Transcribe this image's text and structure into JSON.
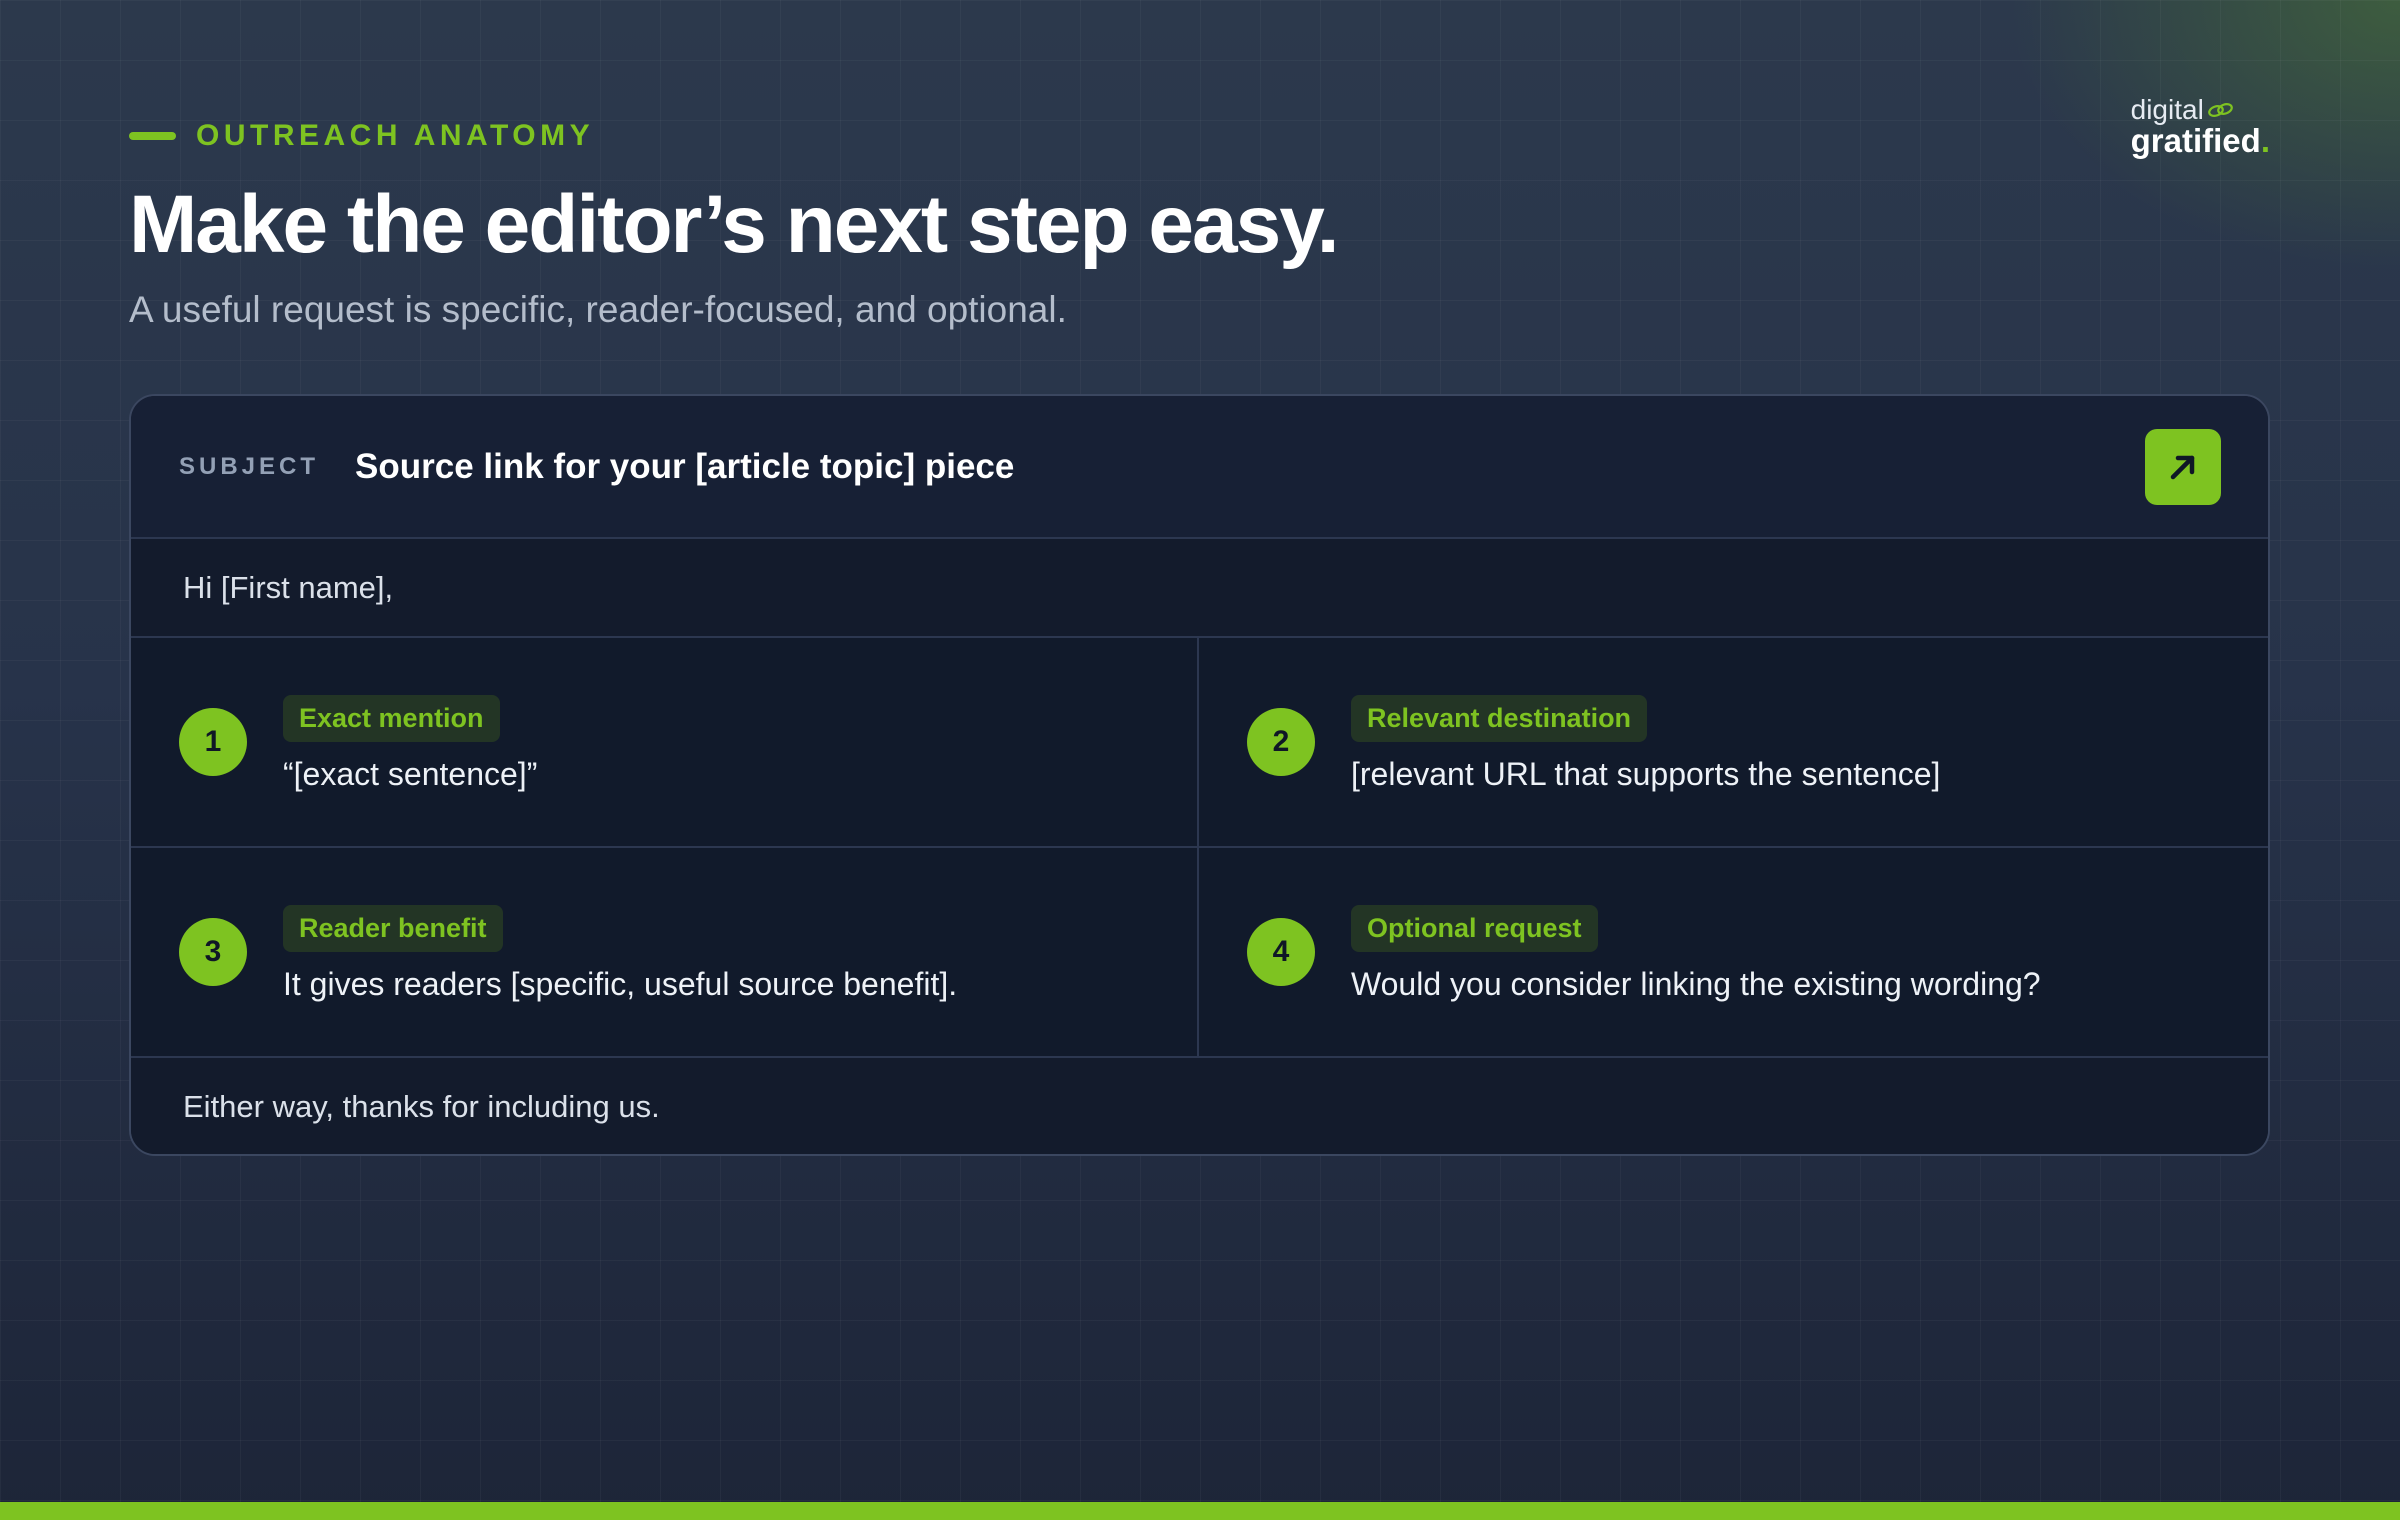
{
  "colors": {
    "accent": "#7ec321",
    "background": "#27334a",
    "card": "#131b2c"
  },
  "header": {
    "eyebrow": "OUTREACH ANATOMY",
    "title": "Make the editor’s next step easy.",
    "subtitle": "A useful request is specific, reader-focused, and optional."
  },
  "logo": {
    "line1": "digital",
    "line2": "gratified",
    "dot": ".",
    "icon": "link-icon"
  },
  "email": {
    "subject_label": "SUBJECT",
    "subject": "Source link for your [article topic] piece",
    "open_icon": "arrow-up-right-icon",
    "greeting": "Hi [First name],",
    "steps": [
      {
        "number": "1",
        "tag": "Exact mention",
        "text": "“[exact sentence]”"
      },
      {
        "number": "2",
        "tag": "Relevant destination",
        "text": "[relevant URL that supports the sentence]"
      },
      {
        "number": "3",
        "tag": "Reader benefit",
        "text": "It gives readers [specific, useful source benefit]."
      },
      {
        "number": "4",
        "tag": "Optional request",
        "text": "Would you consider linking the existing wording?"
      }
    ],
    "signoff": "Either way, thanks for including us."
  }
}
